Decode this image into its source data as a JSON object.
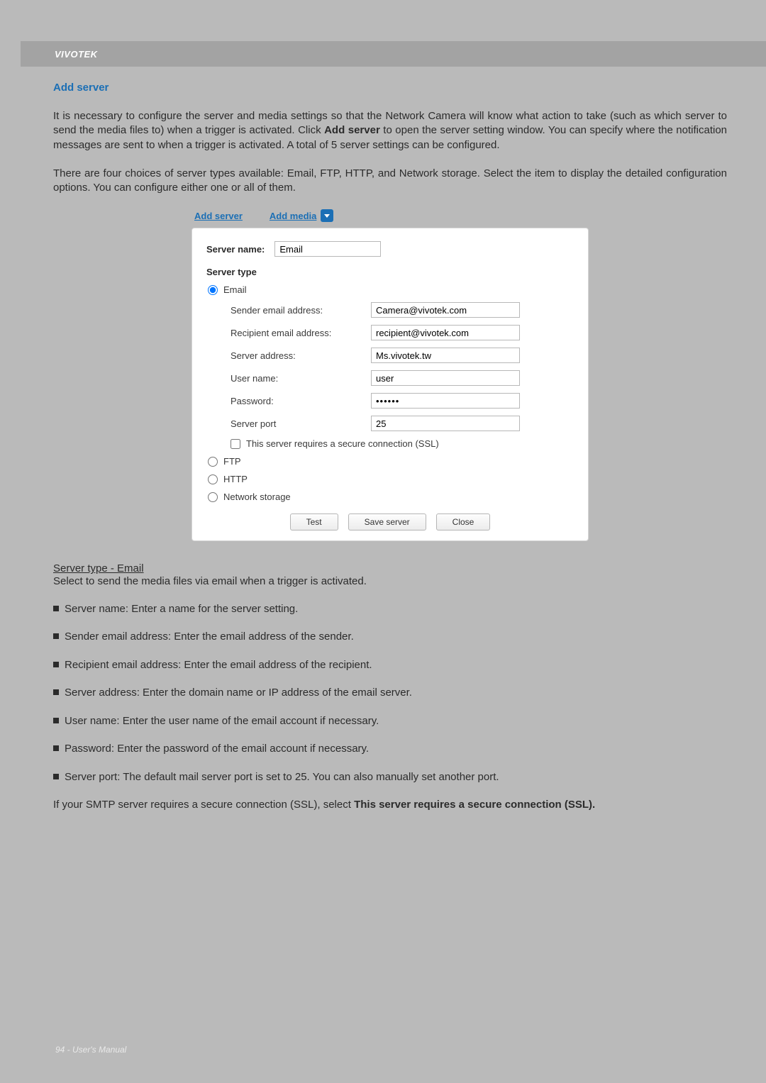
{
  "brand": "VIVOTEK",
  "section_title": "Add server",
  "paragraph1_a": "It is necessary to configure the server and media settings so that the Network Camera will know what action to take (such as which server to send the media files to) when a trigger is activated. Click ",
  "paragraph1_bold": "Add server",
  "paragraph1_b": " to open the server setting window. You can specify where the notification messages are sent to when a trigger is activated. A total of 5 server settings can be configured.",
  "paragraph2": "There are four choices of server types available: Email, FTP, HTTP, and Network storage. Select the item to display the detailed configuration options. You can configure either one or all of them.",
  "tabs": {
    "add_server": "Add server",
    "add_media": "Add media"
  },
  "dialog": {
    "server_name_label": "Server name:",
    "server_name_value": "Email",
    "server_type_label": "Server type",
    "option_email": "Email",
    "option_ftp": "FTP",
    "option_http": "HTTP",
    "option_network_storage": "Network storage",
    "fields": {
      "sender_label": "Sender email address:",
      "sender_value": "Camera@vivotek.com",
      "recipient_label": "Recipient email address:",
      "recipient_value": "recipient@vivotek.com",
      "server_addr_label": "Server address:",
      "server_addr_value": "Ms.vivotek.tw",
      "username_label": "User name:",
      "username_value": "user",
      "password_label": "Password:",
      "password_value": "••••••",
      "port_label": "Server port",
      "port_value": "25"
    },
    "ssl_label": "This server requires a secure connection (SSL)",
    "buttons": {
      "test": "Test",
      "save": "Save server",
      "close": "Close"
    }
  },
  "subhead": "Server type - Email",
  "subdesc": "Select to send the media files via email when a trigger is activated.",
  "bullets": [
    "Server name: Enter a name for the server setting.",
    "Sender email address: Enter the email address of the sender.",
    "Recipient email address: Enter the email address of the recipient.",
    "Server address: Enter the domain name or IP address of the email server.",
    "User name: Enter the user name of the email account if necessary.",
    "Password: Enter the password of the email account if necessary.",
    "Server port: The default mail server port is set to 25. You can also manually set another port."
  ],
  "closing_a": "If your SMTP server requires a secure connection (SSL), select ",
  "closing_bold": "This server requires a secure connection (SSL).",
  "footer": "94 - User's Manual"
}
